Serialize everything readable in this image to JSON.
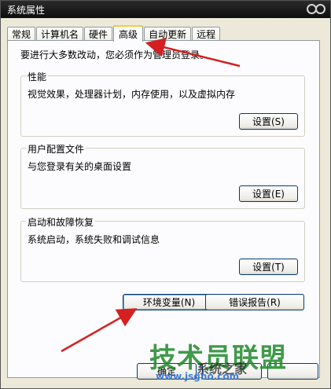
{
  "window": {
    "title": "系统属性"
  },
  "tabs": [
    {
      "label": "常规"
    },
    {
      "label": "计算机名"
    },
    {
      "label": "硬件"
    },
    {
      "label": "高级",
      "active": true
    },
    {
      "label": "自动更新"
    },
    {
      "label": "远程"
    }
  ],
  "intro_text": "要进行大多数改动，您必须作为管理员登录。",
  "groups": {
    "performance": {
      "title": "性能",
      "desc": "视觉效果，处理器计划，内存使用，以及虚拟内存",
      "button": "设置(S)"
    },
    "user_profiles": {
      "title": "用户配置文件",
      "desc": "与您登录有关的桌面设置",
      "button": "设置(E)"
    },
    "startup_recovery": {
      "title": "启动和故障恢复",
      "desc": "系统启动，系统失败和调试信息",
      "button": "设置(T)"
    }
  },
  "env_button": "环境变量(N)",
  "error_button": "错误报告(R)",
  "bottom_buttons": {
    "ok": "确定"
  },
  "watermark": {
    "main": "技术员联盟",
    "sub": "系统之家",
    "url": "www.jsgho.com"
  },
  "colors": {
    "arrow": "#d42020",
    "tab_highlight": "#ffc83c",
    "button_border": "#003c74"
  }
}
